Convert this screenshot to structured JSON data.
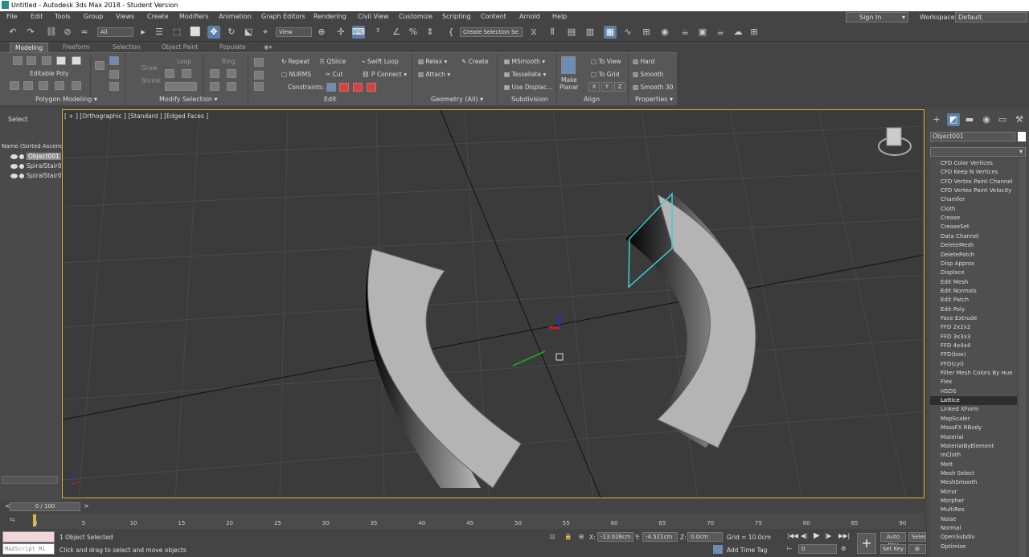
{
  "window": {
    "title": "Untitled - Autodesk 3ds Max 2018 - Student Version"
  },
  "menu": [
    "File",
    "Edit",
    "Tools",
    "Group",
    "Views",
    "Create",
    "Modifiers",
    "Animation",
    "Graph Editors",
    "Rendering",
    "Civil View",
    "Customize",
    "Scripting",
    "Content",
    "Arnold",
    "Help"
  ],
  "account": {
    "sign_in": "Sign In",
    "workspaces_label": "Workspaces:",
    "workspace": "Default"
  },
  "toolbar": {
    "filter": "All",
    "ref_coord": "View",
    "named_selection": "Create Selection Se"
  },
  "ribbon": {
    "tabs": [
      "Modeling",
      "Freeform",
      "Selection",
      "Object Paint",
      "Populate"
    ],
    "active_tab": "Modeling",
    "editable_poly": "Editable Poly",
    "modify_selection": {
      "grow": "Grow",
      "shrink": "Shrink",
      "loop": "Loop",
      "ring": "Ring"
    },
    "edit": {
      "repeat": "Repeat",
      "qslice": "QSlice",
      "swift_loop": "Swift Loop",
      "nurms": "NURMS",
      "cut": "Cut",
      "p_connect": "P Connect",
      "constraints": "Constraints:"
    },
    "geometry": {
      "relax": "Relax",
      "create": "Create",
      "attach": "Attach"
    },
    "subdivision": {
      "msmooth": "MSmooth",
      "tessellate": "Tessellate",
      "use_displac": "Use Displac..."
    },
    "align": {
      "make_planar_1": "Make",
      "make_planar_2": "Planar",
      "to_view": "To View",
      "to_grid": "To Grid",
      "x": "X",
      "y": "Y",
      "z": "Z"
    },
    "properties": {
      "hard": "Hard",
      "smooth": "Smooth",
      "smooth30": "Smooth 30"
    },
    "groups": [
      "Polygon Modeling",
      "Modify Selection",
      "Edit",
      "Geometry (All)",
      "Subdivision",
      "Align",
      "Properties"
    ]
  },
  "scene_explorer": {
    "mode": "Select",
    "header": "Name (Sorted Ascend",
    "items": [
      {
        "name": "Object001",
        "selected": true
      },
      {
        "name": "SpiralStair0",
        "selected": false
      },
      {
        "name": "SpiralStair0",
        "selected": false
      }
    ]
  },
  "viewport": {
    "label": "[ + ] [Orthographic ] [Standard ] [Edged Faces ]"
  },
  "command_panel": {
    "object_name": "Object001",
    "modifiers": [
      "CFD Color Vertices",
      "CFD Keep N Vertices",
      "CFD Vertex Paint Channel",
      "CFD Vertex Paint Velocity",
      "Chamfer",
      "Cloth",
      "Crease",
      "CreaseSet",
      "Data Channel",
      "DeleteMesh",
      "DeletePatch",
      "Disp Approx",
      "Displace",
      "Edit Mesh",
      "Edit Normals",
      "Edit Patch",
      "Edit Poly",
      "Face Extrude",
      "FFD 2x2x2",
      "FFD 3x3x3",
      "FFD 4x4x4",
      "FFD(box)",
      "FFD(cyl)",
      "Filter Mesh Colors By Hue",
      "Flex",
      "HSDS",
      "Lattice",
      "Linked XForm",
      "MapScaler",
      "MassFX RBody",
      "Material",
      "MaterialByElement",
      "mCloth",
      "Melt",
      "Mesh Select",
      "MeshSmooth",
      "Mirror",
      "Morpher",
      "MultiRes",
      "Noise",
      "Normal",
      "OpenSubdiv",
      "Optimize"
    ],
    "selected_modifier": "Lattice"
  },
  "timeline": {
    "frame": "0 / 100",
    "ticks": [
      "0",
      "5",
      "10",
      "15",
      "20",
      "25",
      "30",
      "35",
      "40",
      "45",
      "50",
      "55",
      "60",
      "65",
      "70",
      "75",
      "80",
      "85",
      "90"
    ]
  },
  "status": {
    "maxscript": "MAXScript Mi",
    "selected": "1 Object Selected",
    "prompt": "Click and drag to select and move objects",
    "x_label": "X:",
    "x": "-13.026cm",
    "y_label": "Y:",
    "y": "-4.521cm",
    "z_label": "Z:",
    "z": "0.0cm",
    "grid": "Grid = 10.0cm",
    "add_time_tag": "Add Time Tag",
    "auto_key": "Auto Key",
    "set_key": "Set Key",
    "selected_btn": "Selecte",
    "frame_field": "0"
  },
  "colors": {
    "selection": "#d8b636",
    "accent": "#5b7fa6",
    "highlight_edge": "#39d0d8"
  }
}
